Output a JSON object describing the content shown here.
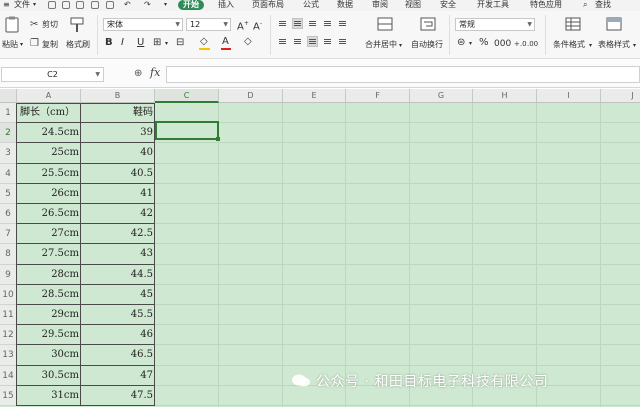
{
  "menubar": {
    "file": "文件",
    "tabs": [
      "开始",
      "插入",
      "页面布局",
      "公式",
      "数据",
      "审阅",
      "视图",
      "安全",
      "开发工具",
      "特色应用"
    ],
    "search": "查找"
  },
  "ribbon": {
    "paste": "粘贴",
    "cut": "剪切",
    "copy": "复制",
    "format_painter": "格式刷",
    "font_name": "宋体",
    "font_size": "12",
    "merge_center": "合并居中",
    "wrap_text": "自动换行",
    "number_format": "常规",
    "conditional_format": "条件格式",
    "table_style": "表格样式"
  },
  "formula_bar": {
    "name_box": "C2",
    "fx_label": "fx",
    "formula": ""
  },
  "sheet": {
    "columns": [
      "A",
      "B",
      "C",
      "D",
      "E",
      "F",
      "G",
      "H",
      "I",
      "J"
    ],
    "selected_column": "C",
    "rows": [
      "1",
      "2",
      "3",
      "4",
      "5",
      "6",
      "7",
      "8",
      "9",
      "10",
      "11",
      "12",
      "13",
      "14",
      "15"
    ],
    "selected_row": "2",
    "header_a": "脚长（cm）",
    "header_b": "鞋码",
    "data": [
      {
        "a": "24.5cm",
        "b": "39"
      },
      {
        "a": "25cm",
        "b": "40"
      },
      {
        "a": "25.5cm",
        "b": "40.5"
      },
      {
        "a": "26cm",
        "b": "41"
      },
      {
        "a": "26.5cm",
        "b": "42"
      },
      {
        "a": "27cm",
        "b": "42.5"
      },
      {
        "a": "27.5cm",
        "b": "43"
      },
      {
        "a": "28cm",
        "b": "44.5"
      },
      {
        "a": "28.5cm",
        "b": "45"
      },
      {
        "a": "29cm",
        "b": "45.5"
      },
      {
        "a": "29.5cm",
        "b": "46"
      },
      {
        "a": "30cm",
        "b": "46.5"
      },
      {
        "a": "30.5cm",
        "b": "47"
      },
      {
        "a": "31cm",
        "b": "47.5"
      }
    ]
  },
  "watermark": "公众号 · 和田目标电子科技有限公司",
  "colors": {
    "grid_background": "#cfe8d1",
    "accent": "#2e7d32",
    "active_tab": "#2e8b57"
  }
}
